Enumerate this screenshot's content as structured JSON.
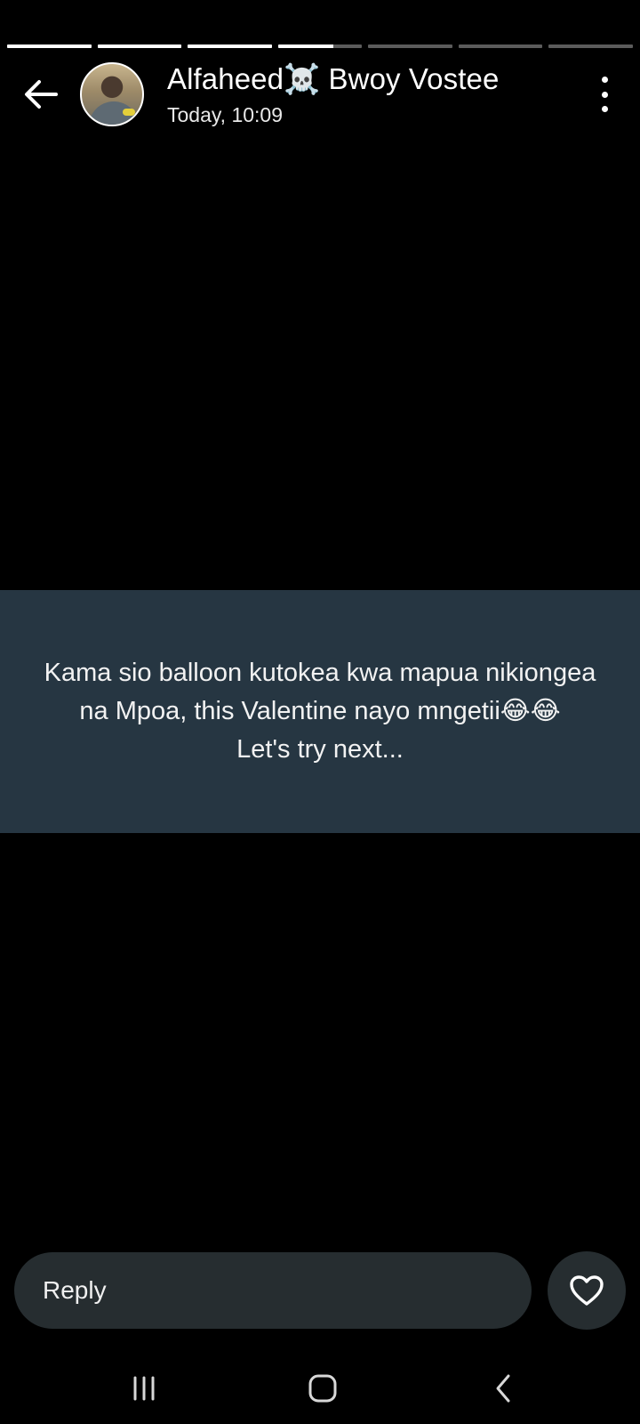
{
  "status": {
    "segments": [
      1,
      1,
      1,
      0.66,
      0,
      0,
      0
    ],
    "author_name": "Alfaheed☠️ Bwoy Vostee",
    "timestamp": "Today, 10:09",
    "text": "Kama sio balloon kutokea kwa mapua nikiongea\nna Mpoa, this Valentine nayo mngetii😂😂\nLet's try next...",
    "background_color": "#263642"
  },
  "icons": {
    "back": "arrow-left-icon",
    "more": "more-vertical-icon",
    "like": "heart-outline-icon",
    "recents": "recents-icon",
    "home": "home-icon",
    "nav_back": "chevron-left-icon"
  },
  "reply": {
    "placeholder": "Reply"
  }
}
